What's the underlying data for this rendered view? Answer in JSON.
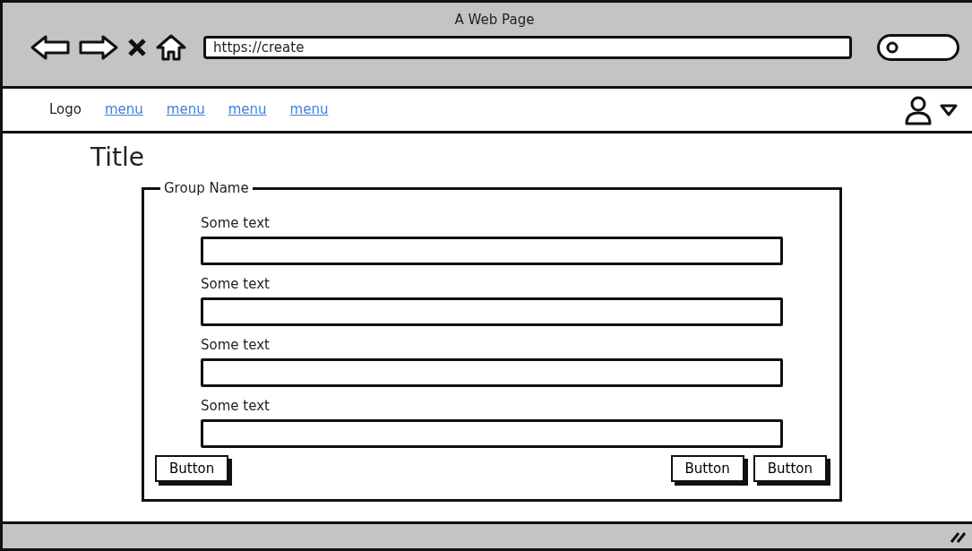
{
  "window": {
    "title": "A Web Page"
  },
  "toolbar": {
    "address": "https://create"
  },
  "navbar": {
    "logo": "Logo",
    "links": [
      "menu",
      "menu",
      "menu",
      "menu"
    ]
  },
  "page": {
    "title": "Title",
    "group": {
      "name": "Group Name",
      "fields": [
        {
          "label": "Some text"
        },
        {
          "label": "Some text"
        },
        {
          "label": "Some text"
        },
        {
          "label": "Some text"
        }
      ],
      "left_buttons": [
        "Button"
      ],
      "right_buttons": [
        "Button",
        "Button"
      ]
    }
  }
}
